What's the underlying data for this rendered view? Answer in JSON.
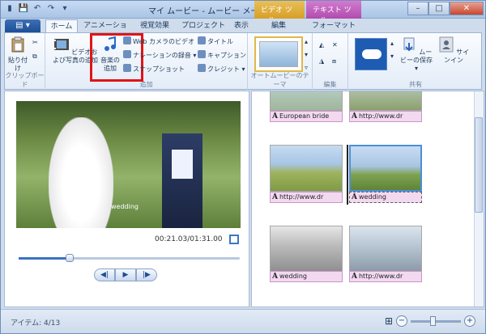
{
  "window": {
    "title": "マイ ムービー - ムービー メーカー",
    "context_tabs": [
      "ビデオ ツール",
      "テキスト ツール"
    ]
  },
  "tabs": {
    "file_menu": "▤ ▾",
    "items": [
      "ホーム",
      "アニメーション",
      "視覚効果",
      "プロジェクト",
      "表示",
      "編集",
      "フォーマット"
    ],
    "active": "ホーム"
  },
  "ribbon": {
    "clipboard": {
      "label": "クリップボード",
      "paste": "貼り付け"
    },
    "add": {
      "label": "追加",
      "add_videos_photos": "ビデオおよび写真の追加",
      "add_music": "音楽の追加",
      "webcam_video": "Web カメラのビデオ",
      "record_narration": "ナレーションの録音",
      "snapshot": "スナップショット",
      "title": "タイトル",
      "caption": "キャプション",
      "credits": "クレジット"
    },
    "automovie": {
      "label": "オートムービーのテーマ"
    },
    "editing": {
      "label": "編集"
    },
    "share": {
      "label": "共有",
      "save_movie": "ムービーの保存",
      "sign_in": "サインイン"
    }
  },
  "preview": {
    "caption": "wedding",
    "timecode": "00:21.03/01:31.00",
    "progress": 0.23
  },
  "storyboard": {
    "captions": [
      "European bride",
      "http://www.dr",
      "http://www.dr",
      "wedding",
      "wedding",
      "http://www.dr"
    ]
  },
  "status": {
    "items": "アイテム: 4/13",
    "zoom": 0.45
  },
  "colors": {
    "highlight": "#e01515",
    "caption_bg": "#f2d9f0",
    "selection": "#4c8fd8"
  }
}
